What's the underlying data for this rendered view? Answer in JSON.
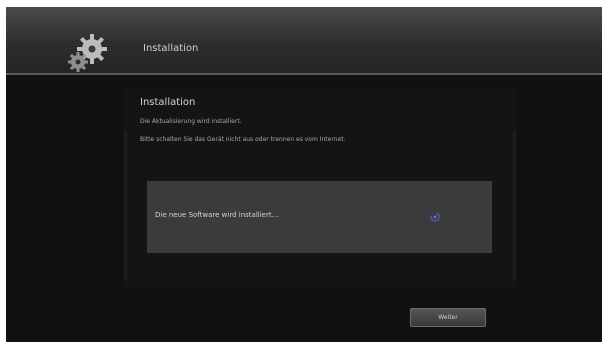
{
  "header": {
    "title": "Installation",
    "icon": "gear-icon"
  },
  "panel": {
    "title": "Installation",
    "line1": "Die Aktualisierung wird installiert.",
    "line2": "Bitte schalten Sie das Gerät nicht aus oder trennen es vom Internet."
  },
  "progress": {
    "text": "Die neue Software wird installiert…",
    "icon": "spinner-icon"
  },
  "buttons": {
    "weiter_label": "Weiter"
  },
  "colors": {
    "background": "#111111",
    "header": "#3a3a3a",
    "progress_box": "#3b3b3b",
    "spinner": "#4a52a0"
  }
}
